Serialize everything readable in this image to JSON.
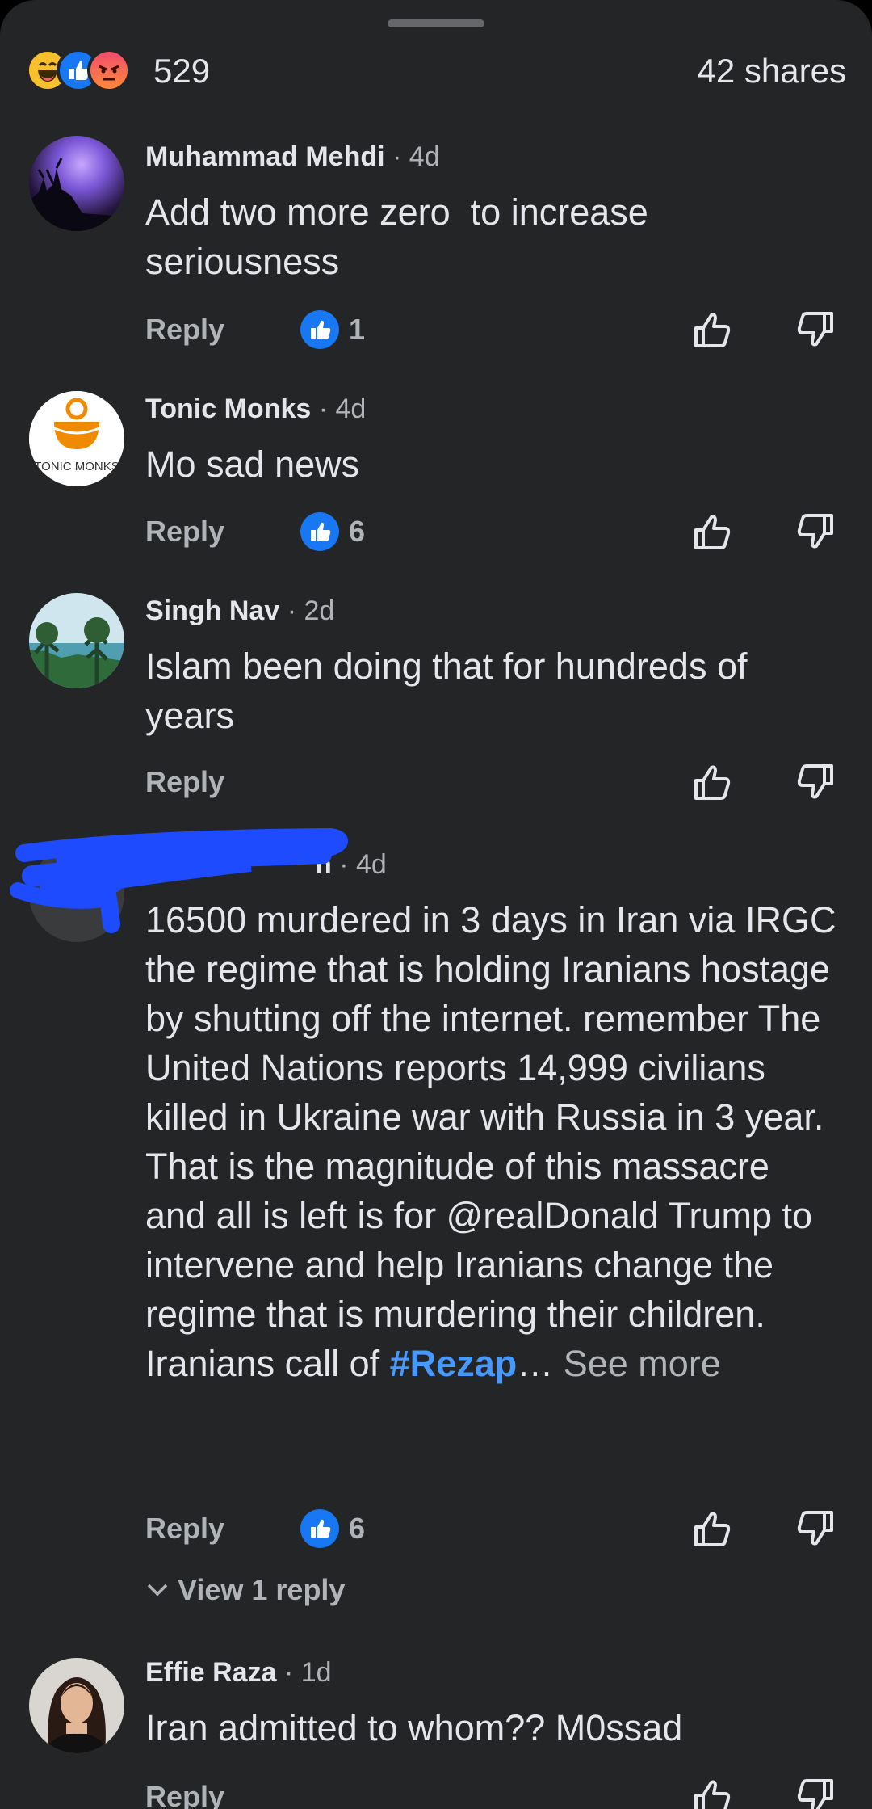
{
  "stats": {
    "reaction_icons": [
      "haha-icon",
      "like-icon",
      "angry-icon"
    ],
    "reaction_count": "529",
    "shares": "42 shares"
  },
  "comments": [
    {
      "author": "Muhammad Mehdi",
      "time": "· 4d",
      "text": "Add two more zero  to increase seriousness",
      "reply_label": "Reply",
      "likes": "1"
    },
    {
      "author": "Tonic Monks",
      "avatar_text": "TONIC MONKS",
      "time": "· 4d",
      "text": "Mo sad news",
      "reply_label": "Reply",
      "likes": "6"
    },
    {
      "author": "Singh Nav",
      "time": "· 2d",
      "text": "Islam been doing that for hundreds of years",
      "reply_label": "Reply",
      "likes": ""
    },
    {
      "author": "n",
      "time": "· 4d",
      "text": "16500 murdered in 3 days in Iran via IRGC the regime that is holding Iranians hostage by shutting off the internet. remember The United Nations reports 14,999 civilians killed in Ukraine war with Russia in 3 year.\nThat is the magnitude of this massacre and all is left is for @realDonald Trump to intervene and help Iranians change the regime that is murdering their children.\nIranians call of ",
      "hashtag": "#Rezap",
      "ellipsis": "…",
      "see_more": " See more",
      "reply_label": "Reply",
      "likes": "6",
      "view_replies": "View 1 reply"
    },
    {
      "author": "Effie Raza",
      "time": "· 1d",
      "text": "Iran admitted to whom?? M0ssad",
      "reply_label": "Reply",
      "likes": ""
    }
  ],
  "colors": {
    "background": "#242526",
    "text": "#e4e6eb",
    "secondary": "#b0b3b8",
    "like_blue": "#1877f2",
    "hashtag": "#4599ff",
    "redaction": "#1f4bff"
  }
}
